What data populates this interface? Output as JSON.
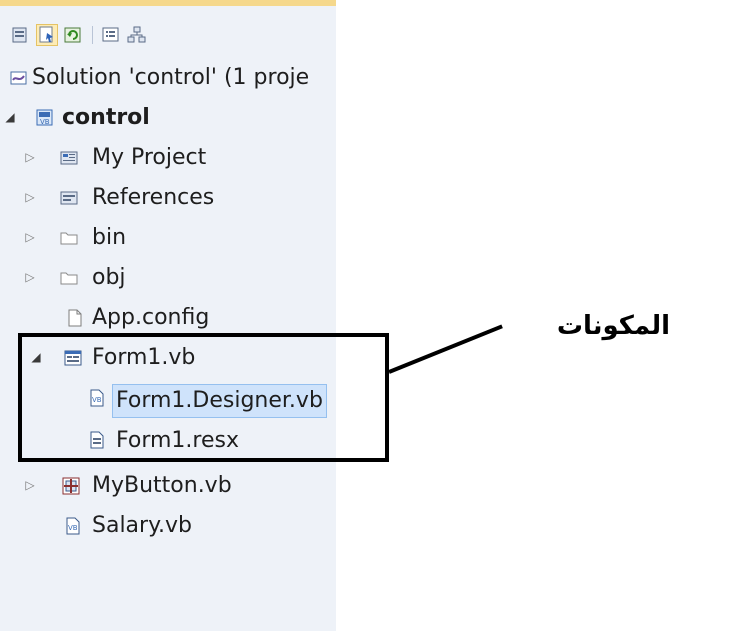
{
  "toolbar": {
    "buttons": [
      {
        "name": "show-all-files-button-icon",
        "active": false
      },
      {
        "name": "properties-button-icon",
        "active": true
      },
      {
        "name": "refresh-button-icon",
        "active": false
      },
      {
        "name": "view-code-button-icon",
        "active": false
      },
      {
        "name": "class-diagram-button-icon",
        "active": false
      }
    ]
  },
  "tree": {
    "solution_label": "Solution 'control' (1 proje",
    "project_label": "control",
    "items": [
      {
        "label": "My Project",
        "icon": "my-project-icon"
      },
      {
        "label": "References",
        "icon": "references-icon"
      },
      {
        "label": "bin",
        "icon": "folder-icon"
      },
      {
        "label": "obj",
        "icon": "folder-icon"
      },
      {
        "label": "App.config",
        "icon": "config-file-icon"
      },
      {
        "label": "Form1.vb",
        "icon": "form-icon"
      },
      {
        "label": "Form1.Designer.vb",
        "icon": "vb-file-icon"
      },
      {
        "label": "Form1.resx",
        "icon": "resx-file-icon"
      },
      {
        "label": "MyButton.vb",
        "icon": "component-icon"
      },
      {
        "label": "Salary.vb",
        "icon": "vb-file-icon"
      }
    ]
  },
  "annotation": {
    "text": "المكونات"
  }
}
